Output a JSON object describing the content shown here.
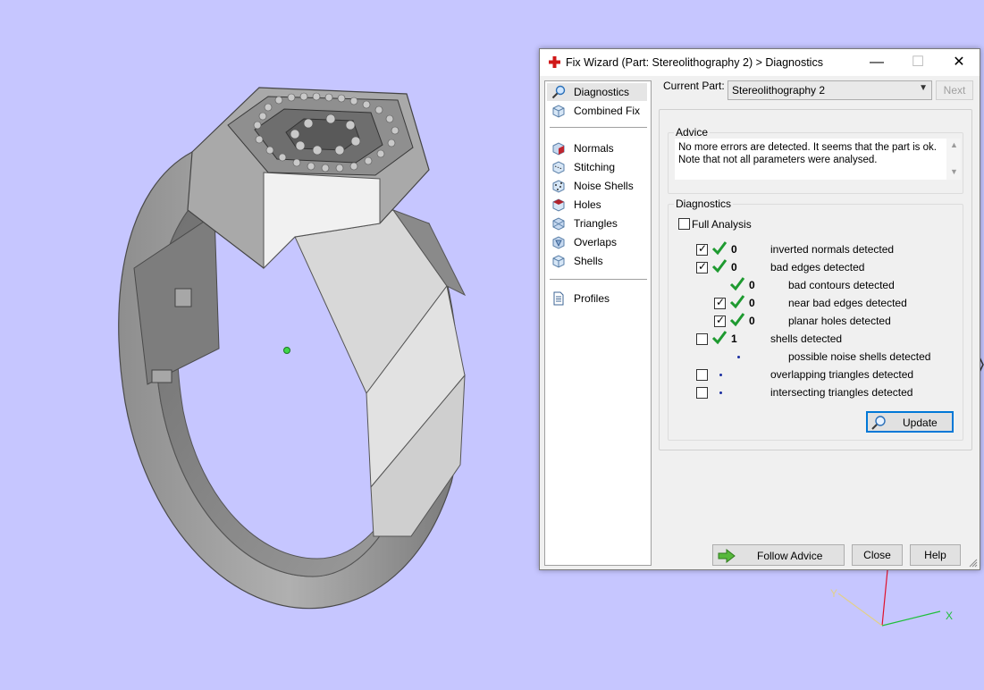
{
  "window": {
    "title": "Fix Wizard (Part: Stereolithography 2) > Diagnostics",
    "minimize": "—",
    "maximize": "☐",
    "close": "✕"
  },
  "nav": {
    "items": [
      {
        "label": "Diagnostics",
        "icon": "magnifier-icon"
      },
      {
        "label": "Combined Fix",
        "icon": "cube-icon"
      },
      {
        "label": "Normals",
        "icon": "normals-cube-icon"
      },
      {
        "label": "Stitching",
        "icon": "stitching-icon"
      },
      {
        "label": "Noise Shells",
        "icon": "noise-shells-icon"
      },
      {
        "label": "Holes",
        "icon": "holes-icon"
      },
      {
        "label": "Triangles",
        "icon": "triangles-icon"
      },
      {
        "label": "Overlaps",
        "icon": "overlaps-icon"
      },
      {
        "label": "Shells",
        "icon": "shells-icon"
      },
      {
        "label": "Profiles",
        "icon": "document-icon"
      }
    ]
  },
  "part": {
    "label": "Current Part:",
    "value": "Stereolithography 2",
    "next": "Next"
  },
  "advice": {
    "title": "Advice",
    "line1": "No more errors are detected. It seems that the part is ok.",
    "line2": "Note that not all parameters were analysed."
  },
  "diagnostics": {
    "title": "Diagnostics",
    "full_analysis": "Full Analysis",
    "rows": [
      {
        "label": "inverted normals detected",
        "count": "0",
        "checked": true
      },
      {
        "label": "bad edges detected",
        "count": "0",
        "checked": true
      },
      {
        "label": "bad contours detected",
        "count": "0"
      },
      {
        "label": "near bad edges detected",
        "count": "0",
        "checked": true
      },
      {
        "label": "planar holes detected",
        "count": "0",
        "checked": true
      },
      {
        "label": "shells detected",
        "count": "1",
        "checked": false
      },
      {
        "label": "possible noise shells detected"
      },
      {
        "label": "overlapping triangles detected",
        "checked": false
      },
      {
        "label": "intersecting triangles detected",
        "checked": false
      }
    ],
    "update": "Update"
  },
  "footer": {
    "follow_advice": "Follow Advice",
    "close": "Close",
    "help": "Help"
  },
  "colors": {
    "viewport_bg": "#c6c6ff",
    "check_green": "#1e9a30",
    "accent_blue": "#0078d7"
  },
  "axes": {
    "x": "X",
    "y": "Y"
  }
}
